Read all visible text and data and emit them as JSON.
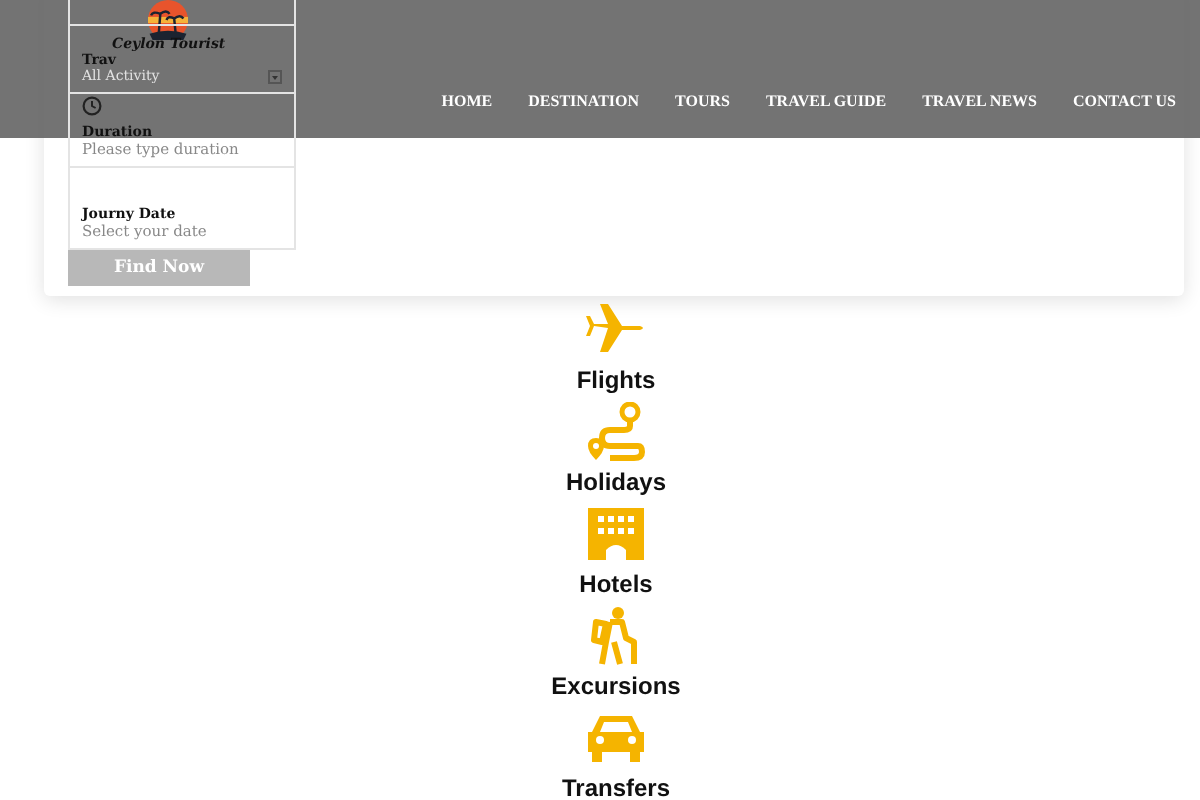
{
  "header": {
    "logo_text": "Ceylon Tourist",
    "nav": [
      {
        "label": "HOME"
      },
      {
        "label": "DESTINATION"
      },
      {
        "label": "TOURS"
      },
      {
        "label": "TRAVEL GUIDE"
      },
      {
        "label": "TRAVEL NEWS"
      },
      {
        "label": "CONTACT US"
      }
    ]
  },
  "search_form": {
    "fields": [
      {
        "kind": "blank"
      },
      {
        "kind": "select",
        "label": "Trav",
        "value": "All Activity"
      },
      {
        "kind": "input",
        "label": "Duration",
        "placeholder": "Please type duration"
      },
      {
        "kind": "input",
        "label": "Journy Date",
        "placeholder": "Select your date"
      }
    ],
    "button": "Find Now"
  },
  "services": [
    {
      "label": "Flights"
    },
    {
      "label": "Holidays"
    },
    {
      "label": "Hotels"
    },
    {
      "label": "Excursions"
    },
    {
      "label": "Transfers"
    }
  ]
}
